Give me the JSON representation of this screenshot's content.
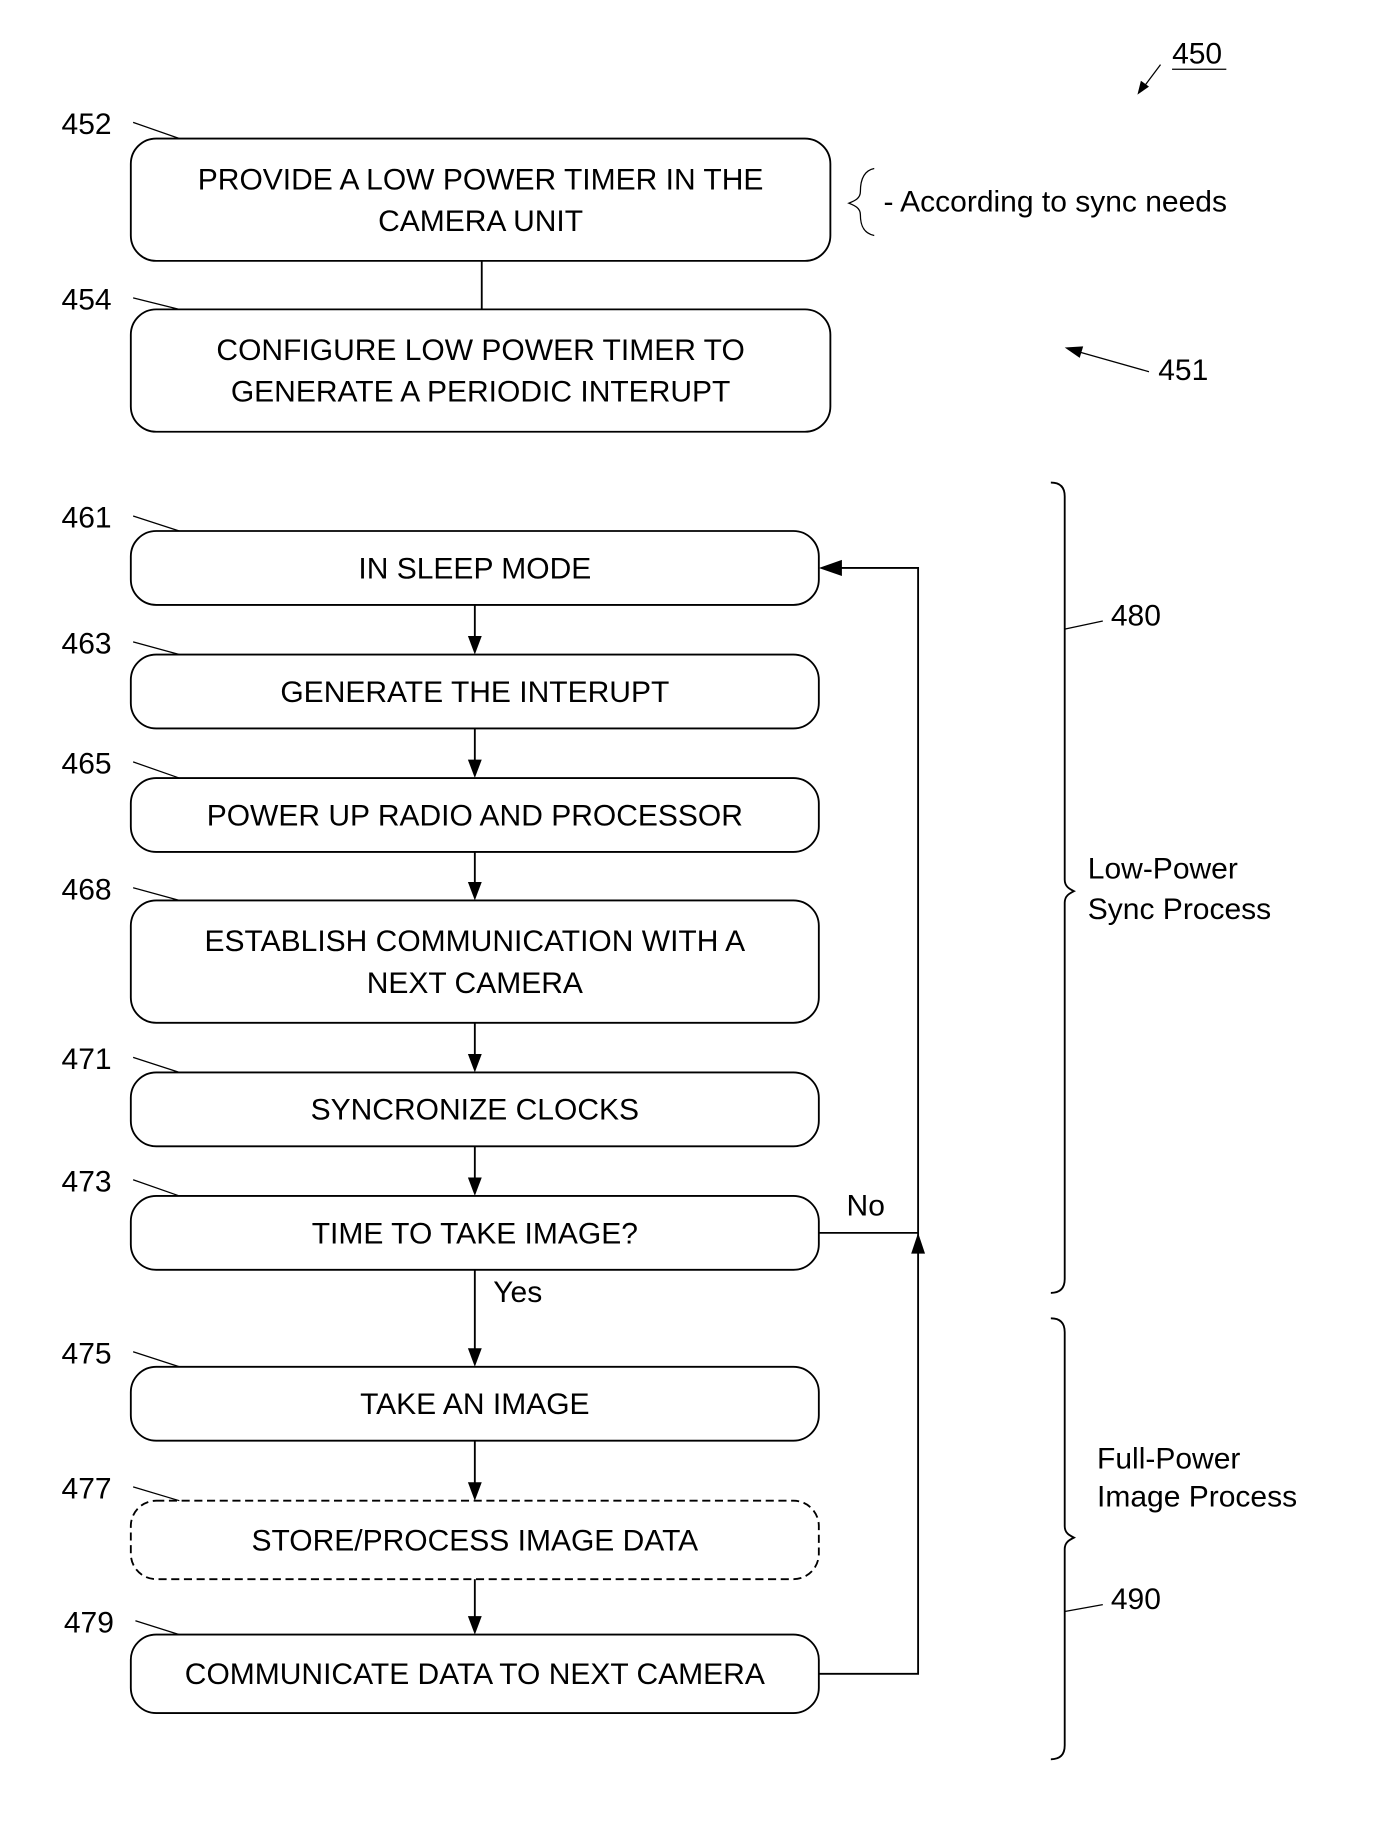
{
  "figure": {
    "ref": "450",
    "process_ref": "451",
    "annotation": "- According to sync needs"
  },
  "steps": [
    {
      "ref": "452",
      "lines": [
        "PROVIDE A LOW POWER TIMER IN THE",
        "CAMERA UNIT"
      ]
    },
    {
      "ref": "454",
      "lines": [
        "CONFIGURE LOW POWER TIMER TO",
        "GENERATE A PERIODIC INTERUPT"
      ]
    },
    {
      "ref": "461",
      "lines": [
        "IN SLEEP MODE"
      ]
    },
    {
      "ref": "463",
      "lines": [
        "GENERATE THE INTERUPT"
      ]
    },
    {
      "ref": "465",
      "lines": [
        "POWER UP RADIO AND PROCESSOR"
      ]
    },
    {
      "ref": "468",
      "lines": [
        "ESTABLISH COMMUNICATION WITH A",
        "NEXT CAMERA"
      ]
    },
    {
      "ref": "471",
      "lines": [
        "SYNCRONIZE CLOCKS"
      ]
    },
    {
      "ref": "473",
      "lines": [
        "TIME TO TAKE IMAGE?"
      ]
    },
    {
      "ref": "475",
      "lines": [
        "TAKE AN IMAGE"
      ]
    },
    {
      "ref": "477",
      "lines": [
        "STORE/PROCESS IMAGE DATA"
      ],
      "optional": true
    },
    {
      "ref": "479",
      "lines": [
        "COMMUNICATE DATA TO NEXT CAMERA"
      ]
    }
  ],
  "branches": {
    "yes": "Yes",
    "no": "No"
  },
  "groups": [
    {
      "ref": "480",
      "label_lines": [
        "Low-Power",
        "Sync Process"
      ]
    },
    {
      "ref": "490",
      "label_lines": [
        "Full-Power",
        "Image Process"
      ]
    }
  ]
}
